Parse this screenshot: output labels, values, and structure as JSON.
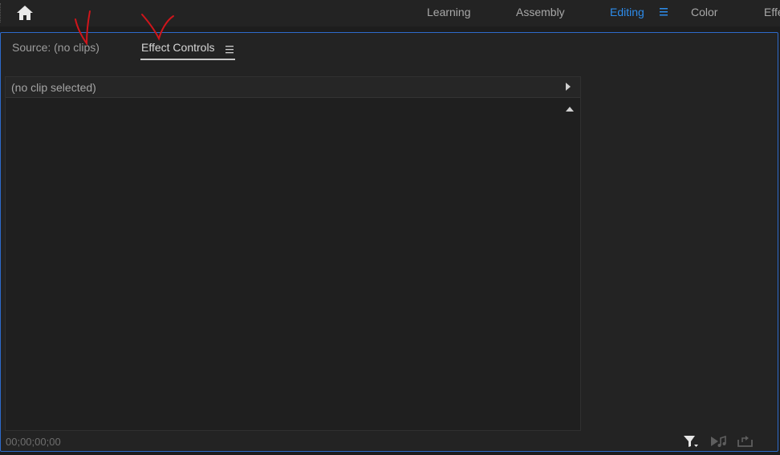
{
  "workspace_bar": {
    "tabs": [
      {
        "label": "Learning"
      },
      {
        "label": "Assembly"
      },
      {
        "label": "Editing"
      },
      {
        "label": "Color"
      },
      {
        "label": "Effe"
      }
    ],
    "active_tab": "Editing",
    "accent_color": "#2d8ceb"
  },
  "panel": {
    "source_tab": "Source: (no clips)",
    "effect_controls_tab": "Effect Controls",
    "active_tab": "Effect Controls",
    "clip_status": "(no clip selected)",
    "timecode": "00;00;00;00",
    "border_color": "#2d6acb"
  },
  "icons": {
    "home": "home-icon",
    "workspace_menu": "hamburger-menu-icon",
    "panel_menu": "hamburger-menu-icon",
    "expand": "triangle-right-icon",
    "collapse": "triangle-up-icon",
    "filter": "filter-icon",
    "play_audio": "play-audio-icon",
    "export": "export-icon"
  },
  "annotations": {
    "color": "#d0151b"
  }
}
